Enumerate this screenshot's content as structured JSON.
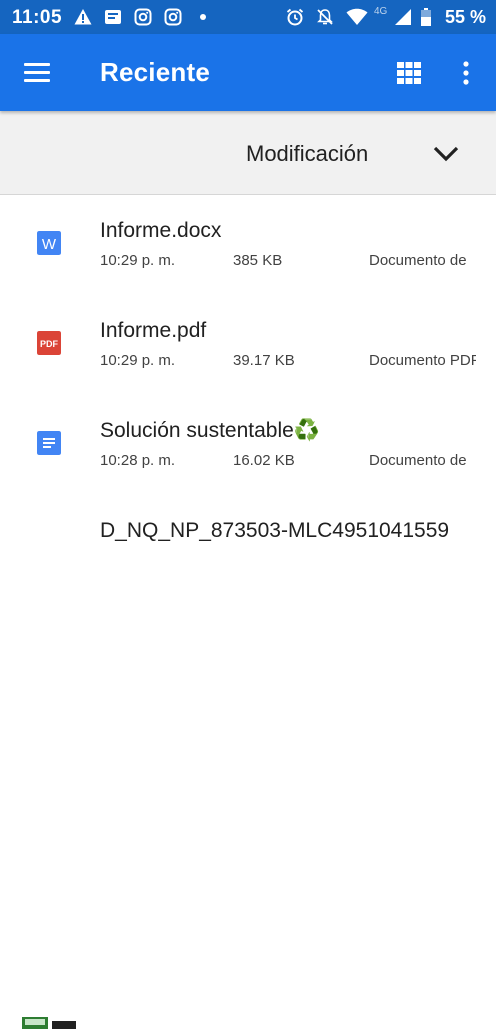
{
  "status_bar": {
    "time": "11:05",
    "network": "4G",
    "battery": "55 %",
    "icons": [
      "warning-icon",
      "message-icon",
      "instagram-icon",
      "instagram-icon",
      "dot-icon",
      "alarm-icon",
      "mute-icon",
      "wifi-icon",
      "signal-icon",
      "battery-icon"
    ]
  },
  "app_bar": {
    "title": "Reciente",
    "menu_icon": "hamburger-menu-icon",
    "grid_icon": "grid-view-icon",
    "more_icon": "more-vert-icon",
    "color": "#1a73e8"
  },
  "sort": {
    "label": "Modificación",
    "icon": "chevron-down-icon"
  },
  "files": [
    {
      "name": "Informe.docx",
      "time": "10:29 p. m.",
      "size": "385 KB",
      "type": "Documento de",
      "icon": "word-icon",
      "icon_color": "#4285f4"
    },
    {
      "name": "Informe.pdf",
      "time": "10:29 p. m.",
      "size": "39.17 KB",
      "type": "Documento PDF",
      "icon": "pdf-icon",
      "icon_color": "#db4437"
    },
    {
      "name": "Solución sustentable♻️",
      "time": "10:28 p. m.",
      "size": "16.02 KB",
      "type": "Documento de",
      "icon": "docs-icon",
      "icon_color": "#4285f4"
    },
    {
      "name": "D_NQ_NP_873503-MLC4951041559",
      "time": "",
      "size": "",
      "type": "",
      "icon": "image-thumbnail-icon",
      "icon_color": "#2e7d32"
    }
  ]
}
